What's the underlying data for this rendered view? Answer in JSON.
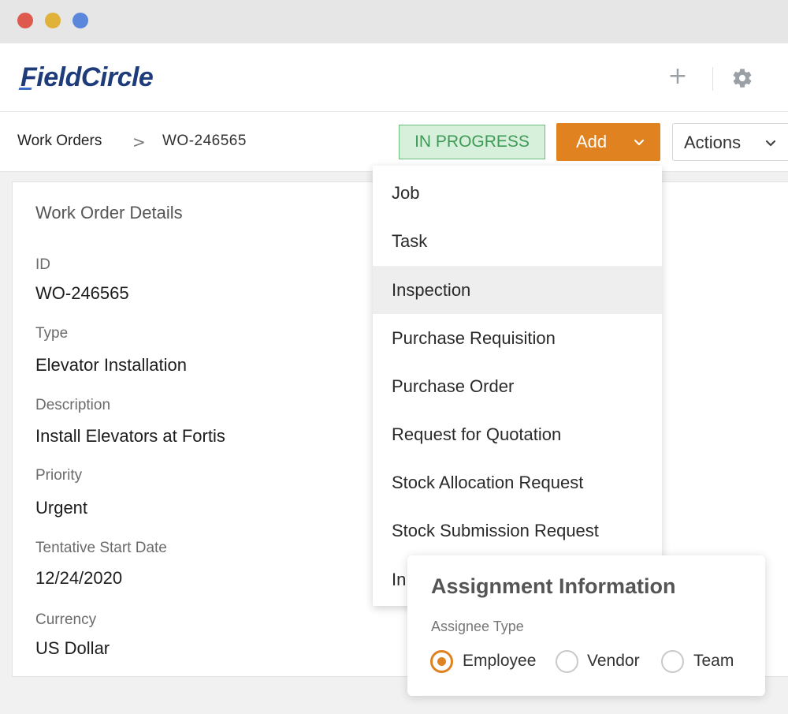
{
  "app": {
    "logo_text": "FieldCircle"
  },
  "header": {
    "add_icon": "plus-icon",
    "settings_icon": "gear-icon"
  },
  "breadcrumb": {
    "root": "Work Orders",
    "separator": ">",
    "current": "WO-246565"
  },
  "status": {
    "label": "IN PROGRESS",
    "color": "#3e9a55"
  },
  "toolbar": {
    "add_label": "Add",
    "actions_label": "Actions",
    "accent": "#e0821f"
  },
  "details": {
    "title": "Work Order Details",
    "fields": [
      {
        "label": "ID",
        "value": "WO-246565"
      },
      {
        "label": "Type",
        "value": "Elevator Installation"
      },
      {
        "label": "Description",
        "value": "Install Elevators at Fortis"
      },
      {
        "label": "Priority",
        "value": "Urgent"
      },
      {
        "label": "Tentative Start Date",
        "value": "12/24/2020"
      },
      {
        "label": "Currency",
        "value": "US Dollar"
      }
    ]
  },
  "add_menu": {
    "items": [
      "Job",
      "Task",
      "Inspection",
      "Purchase Requisition",
      "Purchase Order",
      "Request for Quotation",
      "Stock Allocation Request",
      "Stock Submission Request",
      "In"
    ],
    "highlighted": "Inspection"
  },
  "assignment": {
    "title": "Assignment Information",
    "assignee_type_label": "Assignee Type",
    "options": [
      "Employee",
      "Vendor",
      "Team"
    ],
    "selected": "Employee"
  }
}
